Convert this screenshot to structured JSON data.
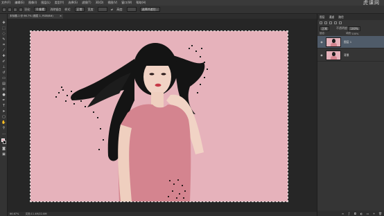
{
  "menu": {
    "items": [
      "文件(F)",
      "编辑(E)",
      "图像(I)",
      "图层(L)",
      "类型(Y)",
      "选择(S)",
      "滤镜(T)",
      "3D(D)",
      "视图(V)",
      "窗口(W)",
      "帮助(H)"
    ],
    "watermark": "虎课网"
  },
  "options": {
    "feather_label": "羽化:",
    "feather_value": "0 像素",
    "antialias_label": "消除锯齿",
    "style_label": "样式:",
    "style_value": "正常",
    "width_label": "宽度:",
    "height_label": "高度:",
    "refine_button": "选择并遮住..."
  },
  "document": {
    "tab_title": "未标题-1 @ 66.7% (图层 1, RGB/8#)",
    "tab_close": "×"
  },
  "status": {
    "zoom": "66.67%",
    "doc_size": "文档:11.4M/22.8M"
  },
  "panels": {
    "tabs": [
      "图层",
      "通道",
      "路径"
    ],
    "blend_mode": "正常",
    "opacity_label": "不透明度:",
    "opacity_value": "100%",
    "lock_label": "锁定:",
    "fill_label": "填充:",
    "fill_value": "100%",
    "layers": [
      {
        "name": "图层 1",
        "selected": true
      },
      {
        "name": "背景",
        "selected": false
      }
    ]
  },
  "colors": {
    "canvas_bg": "#e6b2bb",
    "shirt": "#d4848f",
    "hair": "#141414",
    "skin": "#f1d3c5",
    "selected_layer": "#4f5b69"
  },
  "icons": {
    "visibility": "eye-icon"
  }
}
